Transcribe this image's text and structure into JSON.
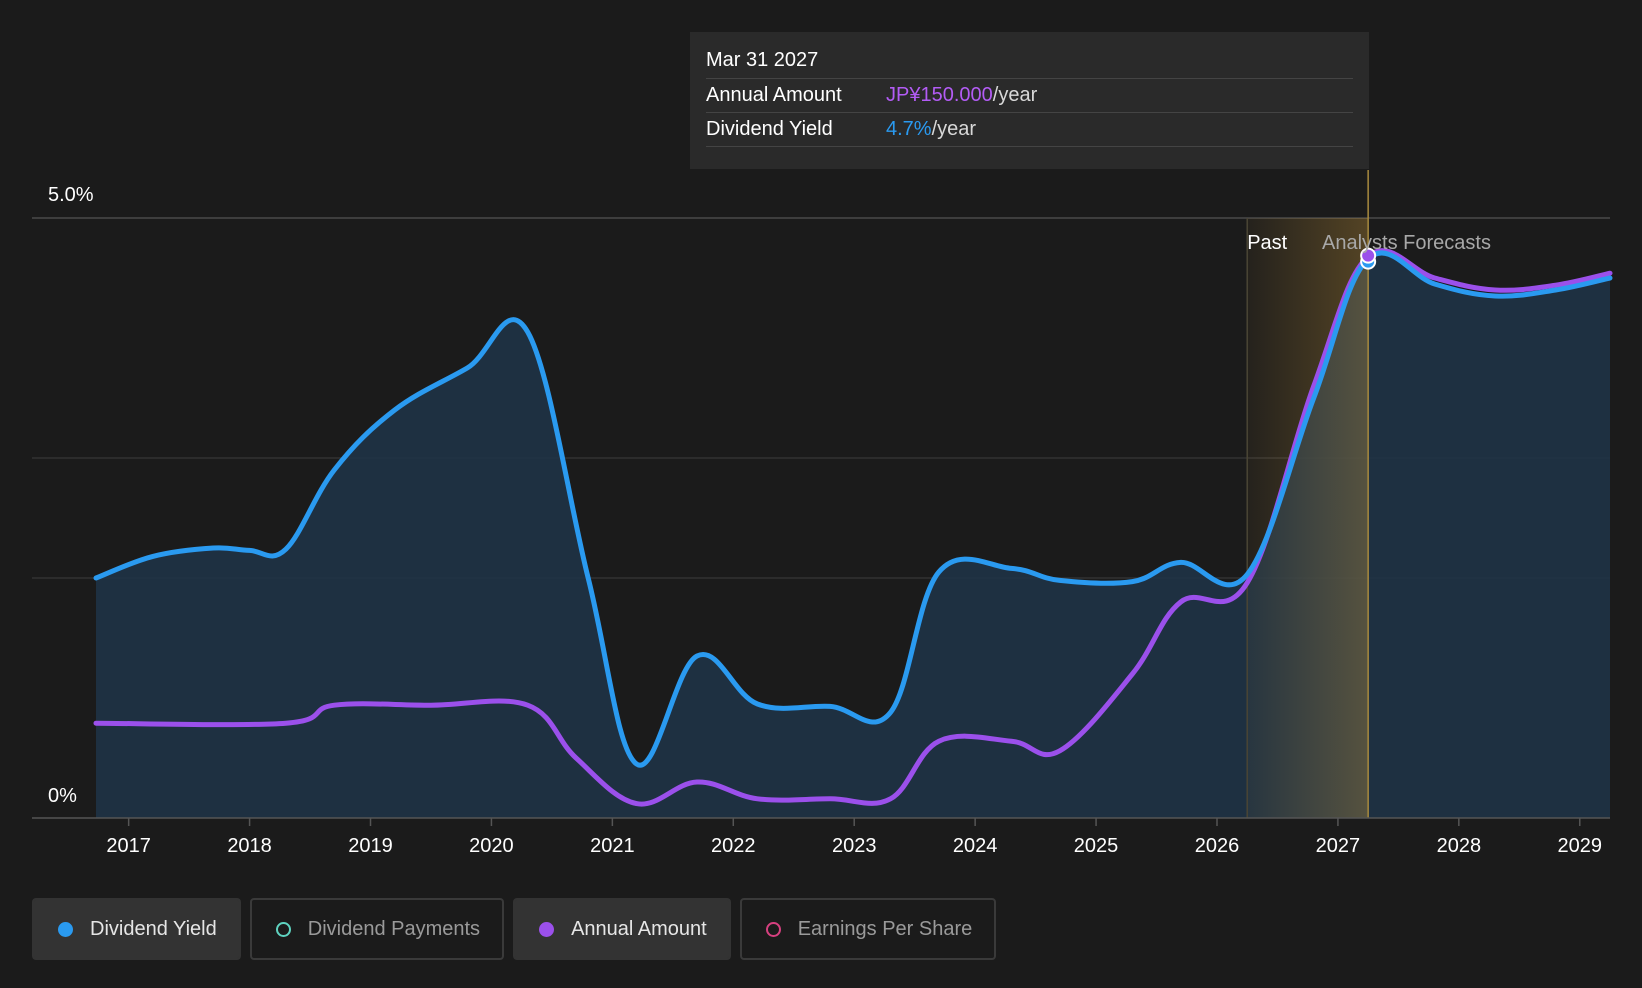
{
  "chart_data": {
    "type": "area",
    "y_tick_labels": [
      "5.0%",
      "0%"
    ],
    "ylim": [
      0,
      5.0
    ],
    "x_tick_labels": [
      "2017",
      "2018",
      "2019",
      "2020",
      "2021",
      "2022",
      "2023",
      "2024",
      "2025",
      "2026",
      "2027",
      "2028",
      "2029"
    ],
    "xlim": [
      2016.73,
      2029.25
    ],
    "region_labels": {
      "past": "Past",
      "forecast": "Analysts Forecasts"
    },
    "past_end": 2026.25,
    "highlight_end": 2027.25,
    "series": [
      {
        "name": "Dividend Yield",
        "color": "#2a9af0",
        "points": [
          [
            2016.73,
            2.0
          ],
          [
            2017.2,
            2.18
          ],
          [
            2017.7,
            2.25
          ],
          [
            2018.0,
            2.23
          ],
          [
            2018.3,
            2.24
          ],
          [
            2018.7,
            2.9
          ],
          [
            2019.2,
            3.4
          ],
          [
            2019.8,
            3.75
          ],
          [
            2020.3,
            4.05
          ],
          [
            2020.8,
            2.0
          ],
          [
            2021.2,
            0.45
          ],
          [
            2021.7,
            1.35
          ],
          [
            2022.2,
            0.95
          ],
          [
            2022.8,
            0.93
          ],
          [
            2023.3,
            0.88
          ],
          [
            2023.7,
            2.05
          ],
          [
            2024.3,
            2.08
          ],
          [
            2024.7,
            1.98
          ],
          [
            2025.3,
            1.97
          ],
          [
            2025.7,
            2.13
          ],
          [
            2026.25,
            2.03
          ],
          [
            2026.8,
            3.5
          ],
          [
            2027.25,
            4.66
          ],
          [
            2027.8,
            4.45
          ],
          [
            2028.3,
            4.35
          ],
          [
            2028.8,
            4.4
          ],
          [
            2029.25,
            4.5
          ]
        ]
      },
      {
        "name": "Annual Amount",
        "color": "#9b50eb",
        "points": [
          [
            2016.73,
            0.79
          ],
          [
            2018.3,
            0.79
          ],
          [
            2018.7,
            0.94
          ],
          [
            2019.5,
            0.94
          ],
          [
            2020.3,
            0.94
          ],
          [
            2020.7,
            0.5
          ],
          [
            2021.2,
            0.12
          ],
          [
            2021.7,
            0.3
          ],
          [
            2022.2,
            0.16
          ],
          [
            2022.8,
            0.16
          ],
          [
            2023.3,
            0.16
          ],
          [
            2023.7,
            0.64
          ],
          [
            2024.3,
            0.64
          ],
          [
            2024.7,
            0.56
          ],
          [
            2025.3,
            1.2
          ],
          [
            2025.7,
            1.8
          ],
          [
            2026.25,
            1.96
          ],
          [
            2026.8,
            3.6
          ],
          [
            2027.25,
            4.68
          ],
          [
            2027.8,
            4.5
          ],
          [
            2028.3,
            4.4
          ],
          [
            2028.8,
            4.44
          ],
          [
            2029.25,
            4.54
          ]
        ]
      }
    ],
    "highlight_point": {
      "x": 2027.25,
      "y": 4.67
    }
  },
  "tooltip": {
    "date": "Mar 31 2027",
    "rows": [
      {
        "label": "Annual Amount",
        "value": "JP¥150.000",
        "unit": "/year",
        "color": "#b35cf5"
      },
      {
        "label": "Dividend Yield",
        "value": "4.7%",
        "unit": "/year",
        "color": "#2a9af0"
      }
    ]
  },
  "legend": [
    {
      "label": "Dividend Yield",
      "color": "#2a9af0",
      "filled": true,
      "active": true
    },
    {
      "label": "Dividend Payments",
      "color": "#5fd3c0",
      "filled": false,
      "active": false
    },
    {
      "label": "Annual Amount",
      "color": "#9b50eb",
      "filled": true,
      "active": true
    },
    {
      "label": "Earnings Per Share",
      "color": "#d6407f",
      "filled": false,
      "active": false
    }
  ]
}
